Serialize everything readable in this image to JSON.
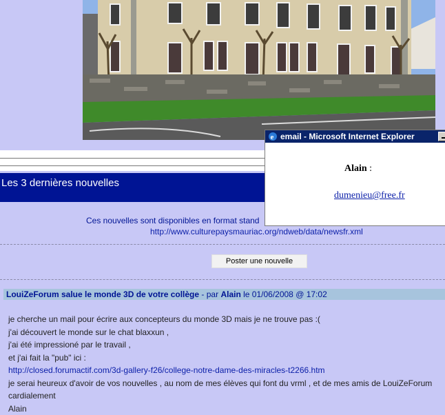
{
  "news": {
    "heading": "Les 3 dernières nouvelles",
    "info_line": "Ces nouvelles sont disponibles en format stand",
    "info_url": "http://www.culturepaysmauriac.org/ndweb/data/newsfr.xml",
    "post_button": "Poster une nouvelle"
  },
  "post": {
    "title": "LouiZeForum salue le monde 3D de votre collège",
    "by_label": "- par",
    "author": "Alain",
    "date_text": "le 01/06/2008 @ 17:02",
    "body": [
      "je cherche un mail pour écrire aux concepteurs du monde 3D mais je ne trouve pas :(",
      "j'ai découvert le monde sur le chat blaxxun ,",
      "j'ai été impressioné par le travail ,",
      "et j'ai fait la \"pub\" ici :",
      "http://closed.forumactif.com/3d-gallery-f26/college-notre-dame-des-miracles-t2266.htm",
      "je serai heureux d'avoir de vos nouvelles , au nom de mes élèves qui font du vrml , et de mes amis de LouiZeForum",
      "cardialement",
      "Alain"
    ]
  },
  "popup": {
    "title": "email - Microsoft Internet Explorer",
    "name": "Alain",
    "name_suffix": " :",
    "email": "dumenieu@free.fr"
  },
  "colors": {
    "page_bg": "#c8c8f6",
    "news_bar": "#001494",
    "post_header": "#a7c4dd",
    "link": "#0a1ea8",
    "popup_titlebar": "#0a246a"
  }
}
